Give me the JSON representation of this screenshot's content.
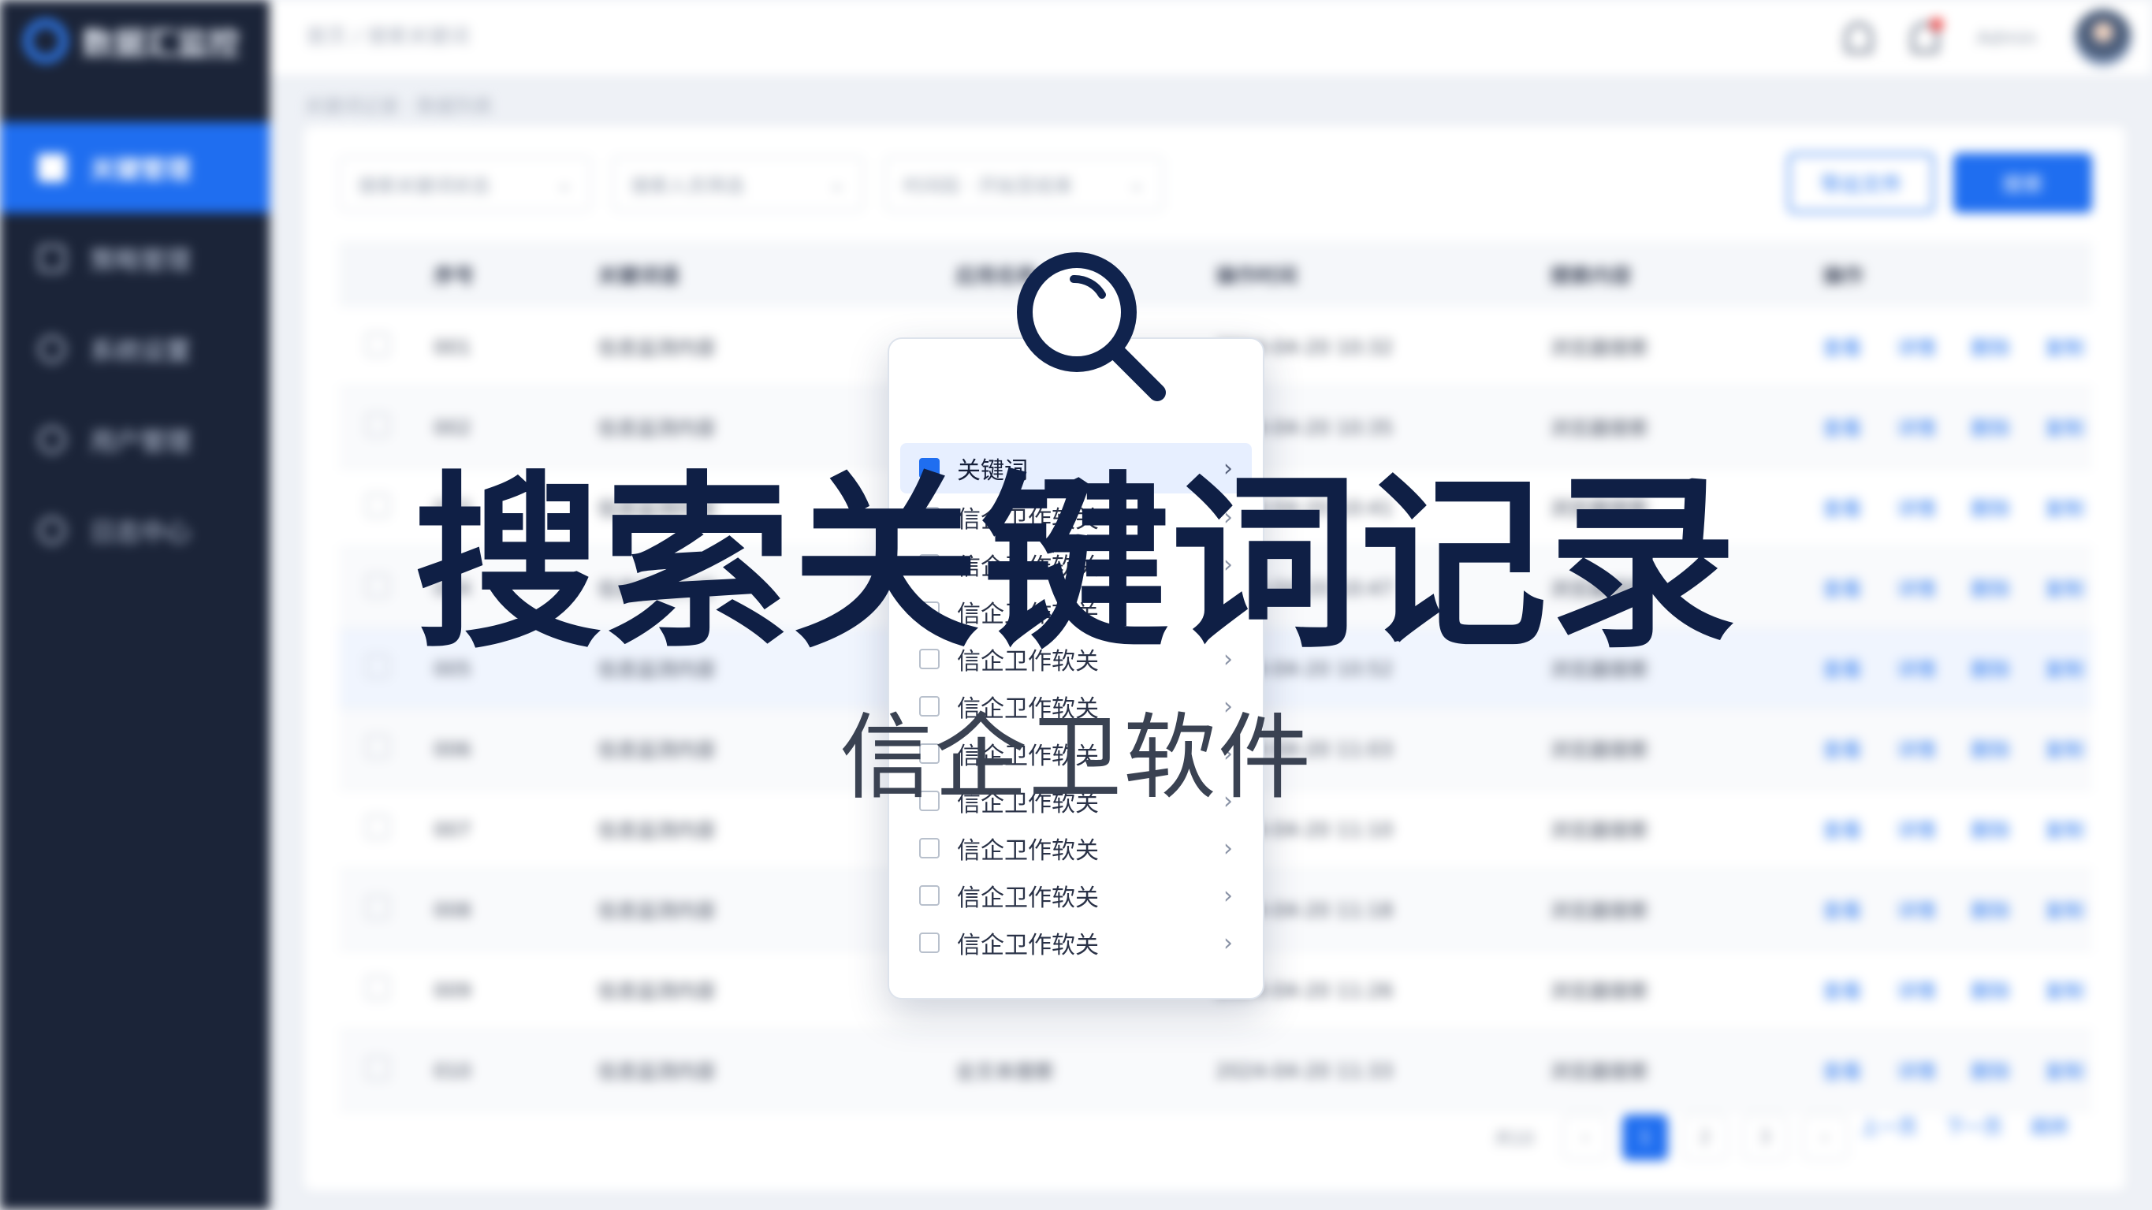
{
  "app": {
    "brand": "数据汇监控"
  },
  "sidebar": {
    "items": [
      {
        "label": "关键管理",
        "icon": "home-icon"
      },
      {
        "label": "策略管理",
        "icon": "list-icon"
      },
      {
        "label": "系统设置",
        "icon": "settings-icon"
      },
      {
        "label": "用户管理",
        "icon": "user-icon"
      },
      {
        "label": "日志中心",
        "icon": "log-icon"
      }
    ]
  },
  "header": {
    "breadcrumb": "首页 / 搜索关键词",
    "username": "Admin"
  },
  "page": {
    "subtitle": "关键词记录 · 数据列表"
  },
  "filters": [
    {
      "placeholder": "搜索关键词状态"
    },
    {
      "placeholder": "搜索人员筛选"
    },
    {
      "placeholder": "时间段 · 开始至结束"
    }
  ],
  "toolbar": {
    "export_label": "导出文件",
    "search_label": "搜索"
  },
  "table": {
    "headers": [
      "",
      "序号",
      "关键词语",
      "应用名称",
      "操作时间",
      "搜索内容",
      "操作"
    ],
    "rows": [
      {
        "id": "001",
        "keyword": "信息监测内容",
        "app": "",
        "time": "2024-04-20 10:32",
        "content": "浏览器搜索"
      },
      {
        "id": "002",
        "keyword": "信息监测内容",
        "app": "",
        "time": "2024-04-20 10:35",
        "content": "浏览器搜索"
      },
      {
        "id": "003",
        "keyword": "信息监测内容",
        "app": "",
        "time": "2024-04-20 10:41",
        "content": "浏览器搜索"
      },
      {
        "id": "004",
        "keyword": "信息监测内容",
        "app": "",
        "time": "2024-04-20 10:47",
        "content": "浏览器搜索"
      },
      {
        "id": "005",
        "keyword": "信息监测内容",
        "app": "",
        "time": "2024-04-20 10:52",
        "content": "浏览器搜索"
      },
      {
        "id": "006",
        "keyword": "信息监测内容",
        "app": "",
        "time": "2024-04-20 11:03",
        "content": "浏览器搜索"
      },
      {
        "id": "007",
        "keyword": "信息监测内容",
        "app": "",
        "time": "2024-04-20 11:10",
        "content": "浏览器搜索"
      },
      {
        "id": "008",
        "keyword": "信息监测内容",
        "app": "",
        "time": "2024-04-20 11:18",
        "content": "浏览器搜索"
      },
      {
        "id": "009",
        "keyword": "信息监测内容",
        "app": "",
        "time": "2024-04-20 11:26",
        "content": "浏览器搜索"
      },
      {
        "id": "010",
        "keyword": "信息监测内容",
        "app": "全文本搜索",
        "time": "2024-04-20 11:33",
        "content": "浏览器搜索"
      }
    ],
    "actions": [
      "查看",
      "详情",
      "删除",
      "复制"
    ]
  },
  "pagination": {
    "total": "共10",
    "pages": [
      "‹",
      "1",
      "2",
      "3",
      "›"
    ],
    "current": "1",
    "tail": [
      "上一页",
      "下一页",
      "跳转"
    ]
  },
  "popup": {
    "header": "关键词",
    "items": [
      "信企卫作软关",
      "信企卫作软关",
      "信企卫作软关",
      "信企卫作软关",
      "信企卫作软关",
      "信企卫作软关",
      "信企卫作软关",
      "信企卫作软关",
      "信企卫作软关",
      "信企卫作软关"
    ],
    "chevron": "›"
  },
  "hero": {
    "title": "搜索关键词记录",
    "subtitle": "信企卫软件"
  },
  "colors": {
    "accent": "#1f6ef0",
    "sidebar": "#1b2438",
    "title": "#0f1f45"
  }
}
